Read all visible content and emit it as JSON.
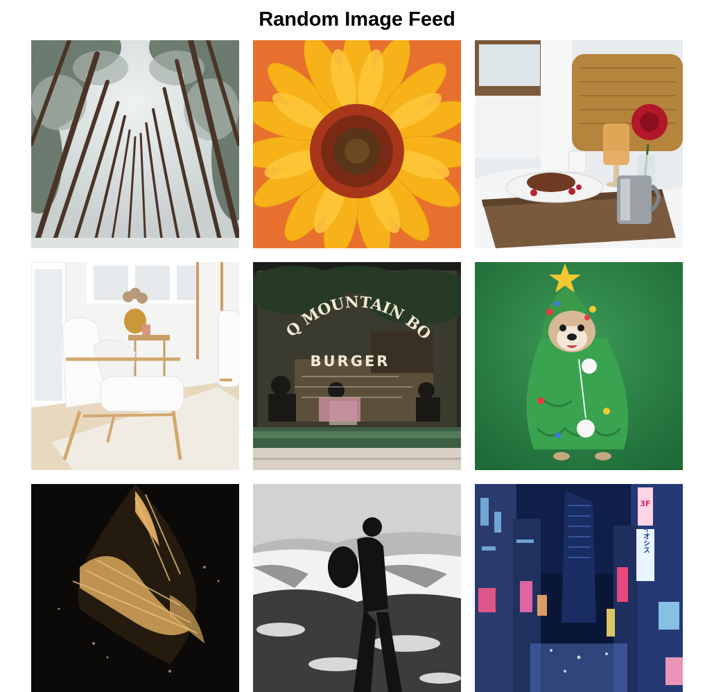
{
  "page": {
    "title": "Random Image Feed"
  },
  "feed": {
    "items": [
      {
        "subject": "snowy pine forest looking up"
      },
      {
        "subject": "sunflower close-up on orange background"
      },
      {
        "subject": "breakfast tray on bed"
      },
      {
        "subject": "white armchair in bright living room"
      },
      {
        "subject": "burger shop window",
        "sign_line_1": "BBQ MOUNTAIN BOYS",
        "sign_line_2": "BURGER"
      },
      {
        "subject": "dog in christmas tree costume on green background"
      },
      {
        "subject": "gold paint brush stroke on black"
      },
      {
        "subject": "black and white hiker silhouette on snowy hills"
      },
      {
        "subject": "neon city street at night",
        "sign_1": "3F",
        "sign_2": "イオシス"
      }
    ]
  },
  "colors": {
    "background": "#ffffff",
    "title": "#000000"
  }
}
